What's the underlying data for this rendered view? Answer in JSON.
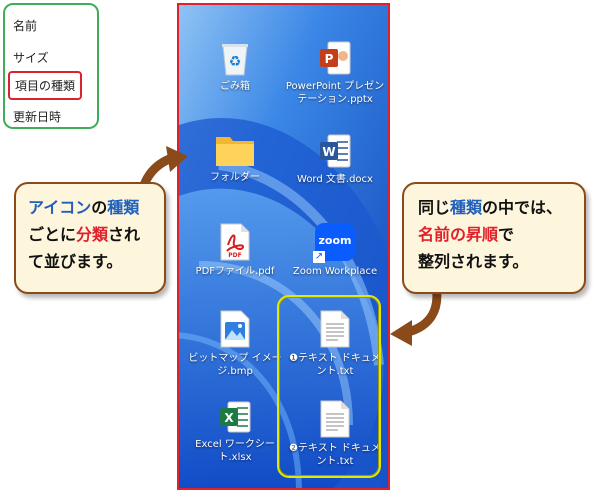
{
  "sort_menu": {
    "items": [
      {
        "label": "名前"
      },
      {
        "label": "サイズ"
      },
      {
        "label": "項目の種類"
      },
      {
        "label": "更新日時"
      }
    ],
    "active_item": "項目の種類"
  },
  "desktop": {
    "icons": [
      {
        "label": "ごみ箱",
        "icon": "recycle-bin-icon"
      },
      {
        "label": "PowerPoint プレゼンテーション.pptx",
        "icon": "powerpoint-file-icon"
      },
      {
        "label": "フォルダー",
        "icon": "folder-icon"
      },
      {
        "label": "Word 文書.docx",
        "icon": "word-file-icon"
      },
      {
        "label": "PDFファイル.pdf",
        "icon": "pdf-file-icon"
      },
      {
        "label": "Zoom Workplace",
        "icon": "zoom-icon",
        "glyph_text": "zoom"
      },
      {
        "label": "ビットマップ イメージ.bmp",
        "icon": "bitmap-image-icon"
      },
      {
        "label": "❶テキスト ドキュメント.txt",
        "icon": "text-document-icon"
      },
      {
        "label": "Excel ワークシート.xlsx",
        "icon": "excel-file-icon"
      },
      {
        "label": "❷テキスト ドキュメント.txt",
        "icon": "text-document-icon"
      }
    ]
  },
  "callout_left": {
    "line1_a": "アイコン",
    "line1_b": "の",
    "line1_c": "種類",
    "line2_a": "ごとに",
    "line2_b": "分類",
    "line2_c": "され",
    "line3": "て並びます。"
  },
  "callout_right": {
    "line1_a": "同じ",
    "line1_b": "種類",
    "line1_c": "の中では、",
    "line2_a": "名前の昇順",
    "line2_b": "で",
    "line3": "整列されます。"
  },
  "colors": {
    "menu_border": "#3fae5a",
    "highlight_red": "#e0202a",
    "highlight_yellow": "#e2e800",
    "callout_fill": "#fdf5dc",
    "callout_border": "#8a4a1a",
    "emphasis_blue": "#1f5fbd"
  }
}
